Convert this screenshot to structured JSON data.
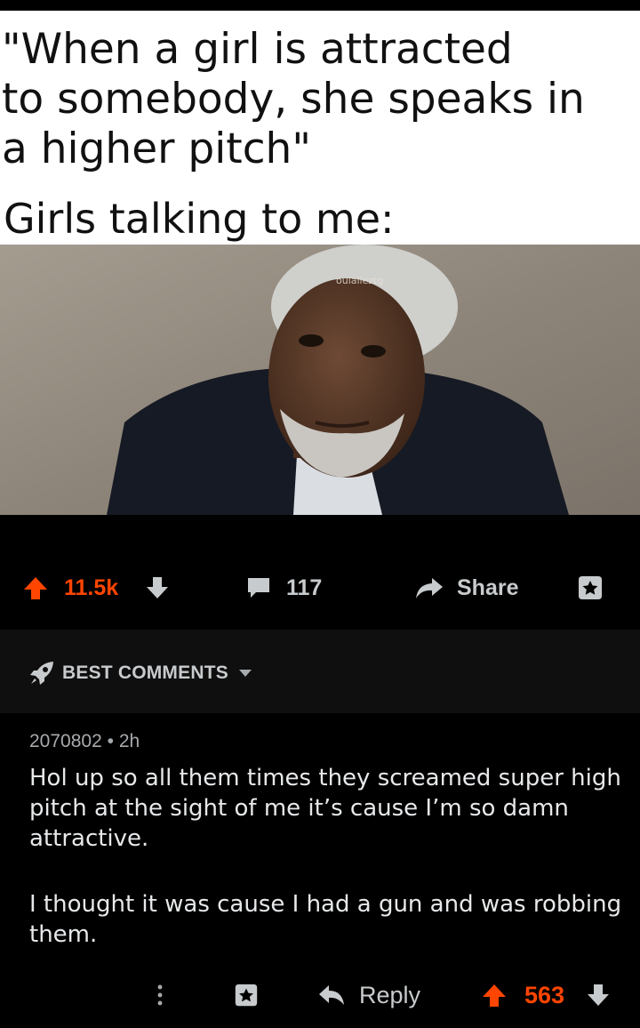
{
  "meme": {
    "caption_lines": [
      "\"When a girl is attracted",
      "to somebody, she speaks in",
      "a higher pitch\"",
      "Girls talking to me:"
    ],
    "watermark": "ouialleztg"
  },
  "post_actions": {
    "score": "11.5k",
    "comments_count": "117",
    "share_label": "Share"
  },
  "sort": {
    "label": "BEST COMMENTS"
  },
  "comment": {
    "author": "2070802",
    "separator": "•",
    "age": "2h",
    "paragraphs": [
      "Hol up so all them times they screamed super high pitch at the sight of me it’s cause I’m so damn attractive.",
      "I thought it was cause I had a gun and was robbing them."
    ],
    "reply_label": "Reply",
    "score": "563"
  },
  "colors": {
    "accent": "#ff4500",
    "background": "#000000",
    "panel": "#0f0f0f",
    "text": "#e6e8ea"
  },
  "icons": [
    "upvote-icon",
    "downvote-icon",
    "comment-icon",
    "share-icon",
    "save-icon",
    "rocket-icon",
    "chevron-down-icon",
    "more-icon",
    "reply-icon"
  ]
}
